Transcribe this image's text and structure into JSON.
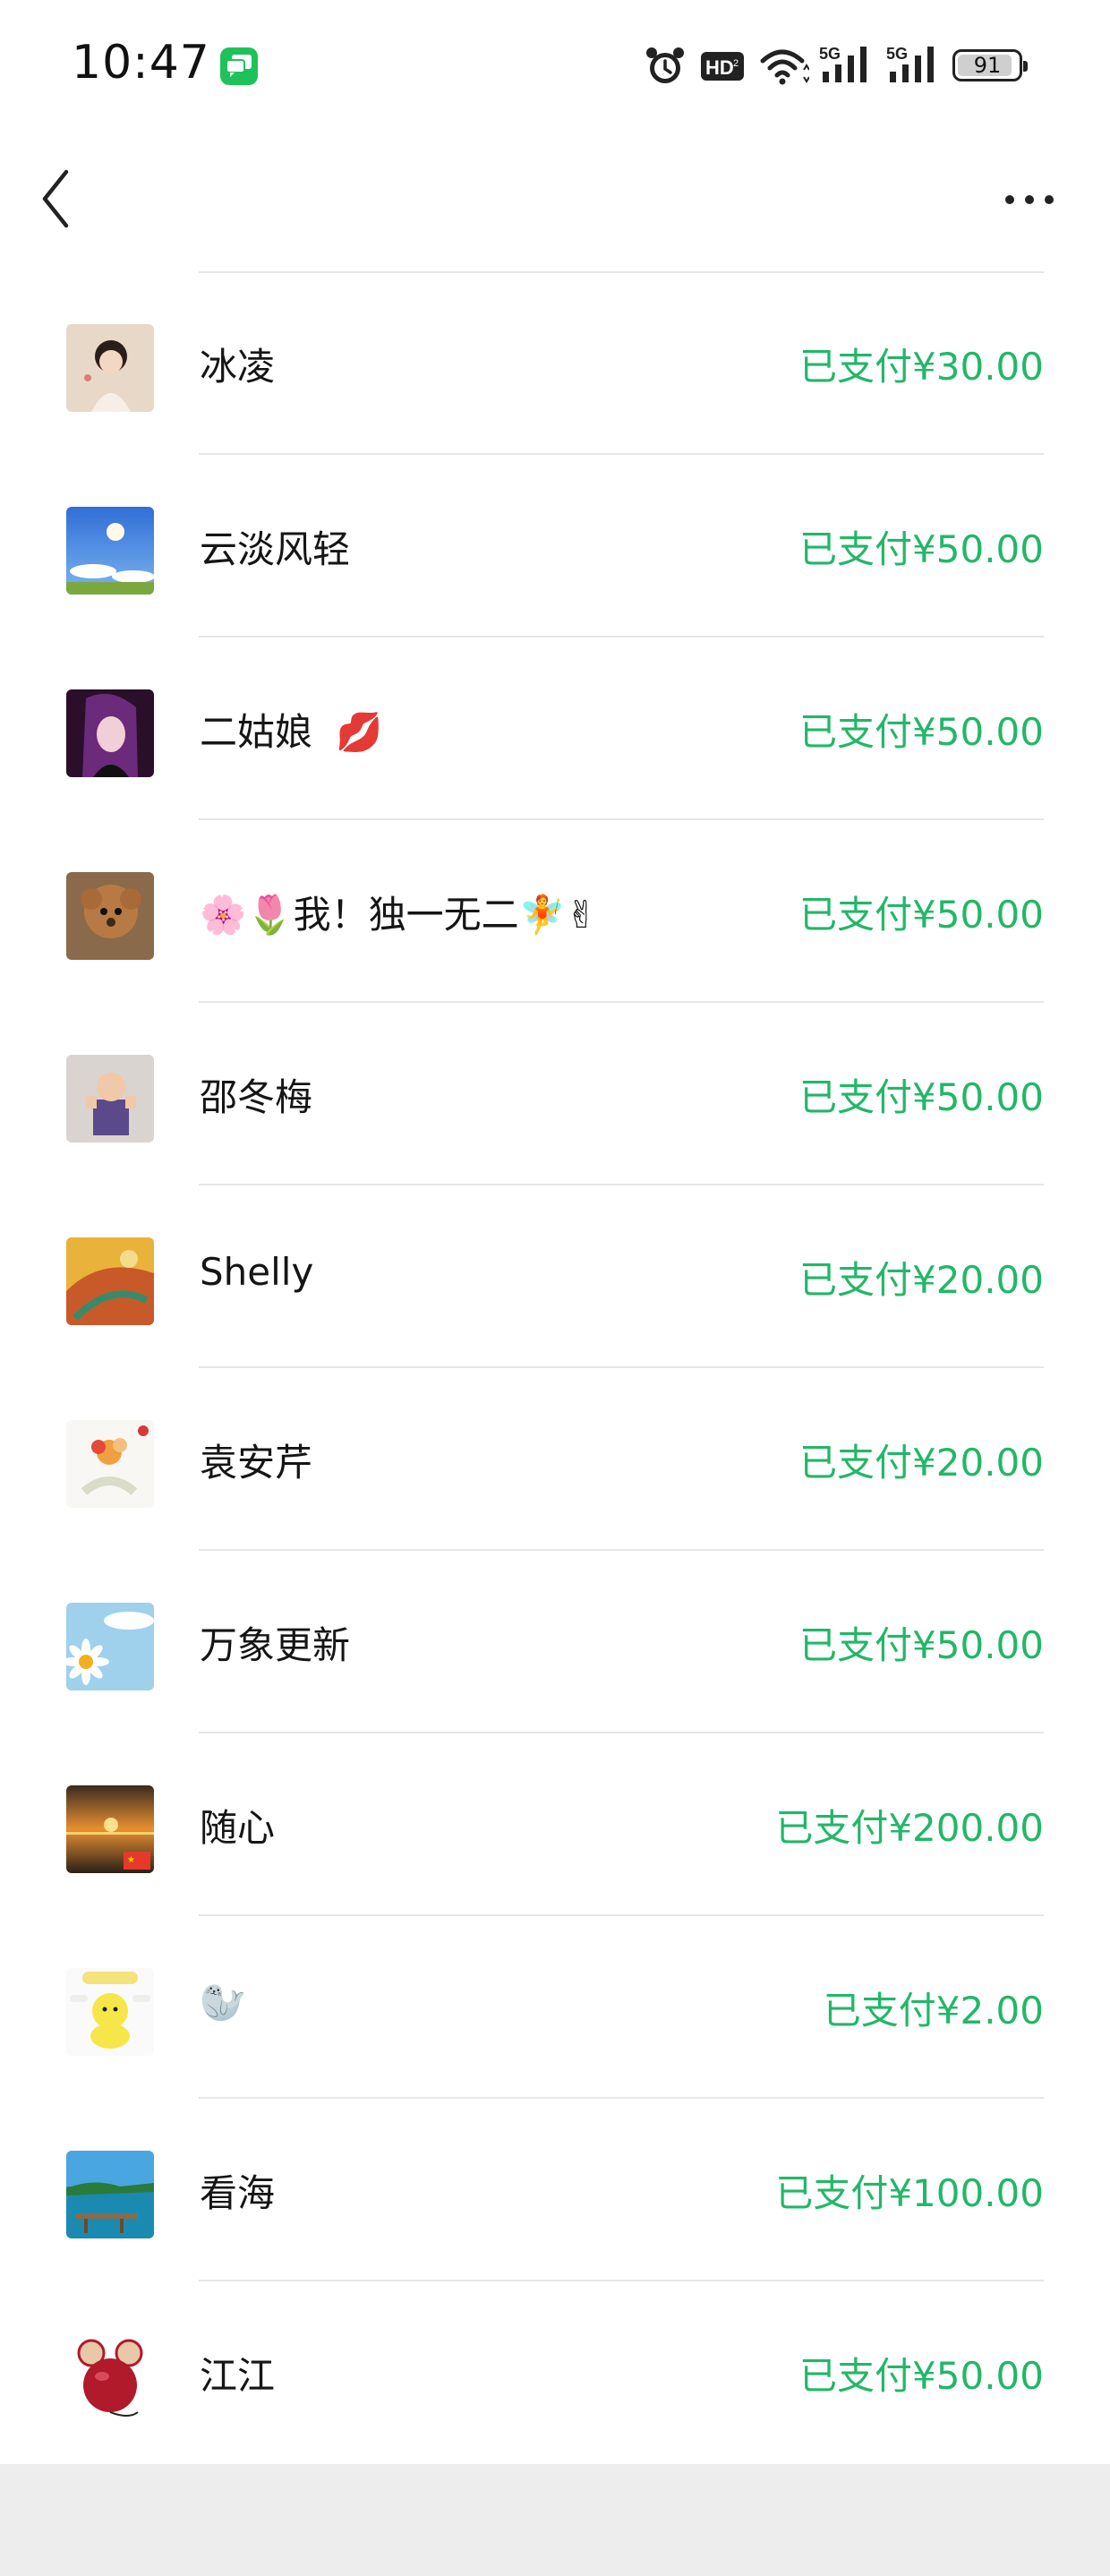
{
  "status_bar": {
    "time": "10:47",
    "battery": "91",
    "battery_level": 0.91,
    "icons": [
      "messages-app-icon",
      "alarm-icon",
      "hd-icon",
      "wifi-icon",
      "signal-5g-icon",
      "signal-5g-icon",
      "battery-icon"
    ]
  },
  "nav": {
    "back_icon": "chevron-left-icon",
    "more_icon": "more-dots-icon"
  },
  "colors": {
    "paid_text": "#22b768",
    "divider": "#e6e6e6",
    "footer_bg": "#ededed"
  },
  "payers": [
    {
      "name": "冰凌",
      "status": "已支付¥30.00",
      "emoji": ""
    },
    {
      "name": "云淡风轻",
      "status": "已支付¥50.00",
      "emoji": ""
    },
    {
      "name": "二姑娘",
      "status": "已支付¥50.00",
      "emoji": "💋"
    },
    {
      "name": "🌸🌷我！独一无二🧚✌",
      "status": "已支付¥50.00",
      "emoji": ""
    },
    {
      "name": "邵冬梅",
      "status": "已支付¥50.00",
      "emoji": ""
    },
    {
      "name": "Shelly",
      "status": "已支付¥20.00",
      "emoji": ""
    },
    {
      "name": "袁安芹",
      "status": "已支付¥20.00",
      "emoji": ""
    },
    {
      "name": "万象更新",
      "status": "已支付¥50.00",
      "emoji": ""
    },
    {
      "name": "随心",
      "status": "已支付¥200.00",
      "emoji": ""
    },
    {
      "name": "🦭",
      "status": "已支付¥2.00",
      "emoji": ""
    },
    {
      "name": "看海",
      "status": "已支付¥100.00",
      "emoji": ""
    },
    {
      "name": "江江",
      "status": "已支付¥50.00",
      "emoji": ""
    }
  ]
}
